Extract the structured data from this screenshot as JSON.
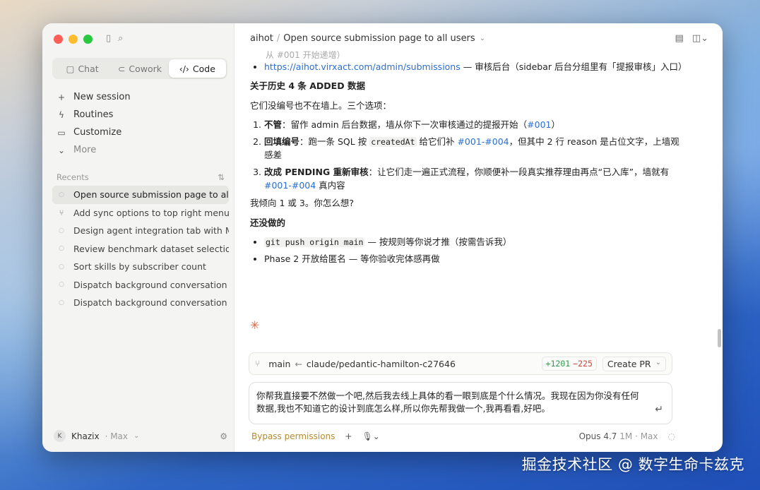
{
  "sidebar": {
    "modes": [
      {
        "label": "Chat",
        "icon": "chat-bubble-icon"
      },
      {
        "label": "Cowork",
        "icon": "cowork-icon"
      },
      {
        "label": "Code",
        "icon": "code-brackets-icon"
      }
    ],
    "active_mode": "Code",
    "nav": [
      {
        "label": "New session",
        "icon": "plus-icon"
      },
      {
        "label": "Routines",
        "icon": "lightning-icon"
      },
      {
        "label": "Customize",
        "icon": "briefcase-icon"
      },
      {
        "label": "More",
        "icon": "chevron-down-icon"
      }
    ],
    "recents_label": "Recents",
    "recents": [
      {
        "label": "Open source submission page to all users",
        "icon": "dot-icon",
        "active": true
      },
      {
        "label": "Add sync options to top right menu",
        "icon": "branch-icon"
      },
      {
        "label": "Design agent integration tab with MCP",
        "icon": "dot-icon"
      },
      {
        "label": "Review benchmark dataset selection",
        "icon": "dot-icon"
      },
      {
        "label": "Sort skills by subscriber count",
        "icon": "dot-icon"
      },
      {
        "label": "Dispatch background conversation",
        "icon": "dot-icon"
      },
      {
        "label": "Dispatch background conversation",
        "icon": "dot-icon"
      }
    ],
    "user": {
      "initial": "K",
      "name": "Khazix",
      "plan": "· Max"
    }
  },
  "header": {
    "project": "aihot",
    "separator": "/",
    "title": "Open source submission page to all users"
  },
  "content": {
    "faded_line": "从 #001 开始递增）",
    "bullet1_link": "https://aihot.virxact.com/admin/submissions",
    "bullet1_rest": " — 审核后台（sidebar 后台分组里有「提报审核」入口）",
    "heading1": "关于历史 4 条 ADDED 数据",
    "para1": "它们没编号也不在墙上。三个选项：",
    "opt1_bold": "不管",
    "opt1_text": "：留作 admin 后台数据，墙从你下一次审核通过的提报开始（",
    "opt1_link": "#001",
    "opt1_end": "）",
    "opt2_bold": "回填编号",
    "opt2_text1": "：跑一条 SQL 按 ",
    "opt2_code": "createdAt",
    "opt2_text2": " 给它们补 ",
    "opt2_link": "#001-#004",
    "opt2_text3": "，但其中 2 行 reason 是占位文字，上墙观感差",
    "opt3_bold": "改成 PENDING 重新审核",
    "opt3_text1": "：让它们走一遍正式流程，你顺便补一段真实推荐理由再点“已入库”，墙就有 ",
    "opt3_link": "#001-#004",
    "opt3_text2": " 真内容",
    "para2": "我倾向 1 或 3。你怎么想?",
    "heading2": "还没做的",
    "todo1_code": "git push origin main",
    "todo1_text": " — 按规则等你说才推（按需告诉我）",
    "todo2_text": "Phase 2 开放给匿名 — 等你验收完体感再做"
  },
  "branchbar": {
    "base": "main",
    "arrow": "←",
    "branch": "claude/pedantic-hamilton-c27646",
    "additions": "+1201",
    "deletions": "−225",
    "create_pr": "Create PR"
  },
  "composer": {
    "text": "你帮我直接要不然做一个吧,然后我去线上具体的看一眼到底是个什么情况。我现在因为你没有任何数据,我也不知道它的设计到底怎么样,所以你先帮我做一个,我再看看,好吧。"
  },
  "footer": {
    "permissions": "Bypass permissions",
    "model": "Opus 4.7",
    "context": "1M · Max"
  },
  "watermark": "掘金技术社区 @ 数字生命卡兹克",
  "colors": {
    "accent_link": "#2a6fd1",
    "additions": "#2e9a4b",
    "deletions": "#c9453b",
    "bypass": "#b38a2e",
    "spark": "#d46b4a"
  }
}
